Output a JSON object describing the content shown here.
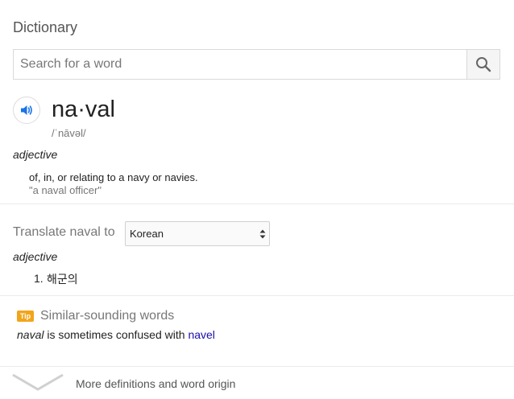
{
  "header": {
    "title": "Dictionary"
  },
  "search": {
    "placeholder": "Search for a word",
    "value": "",
    "icon": "search-icon"
  },
  "entry": {
    "headword": "na·val",
    "pronunciation": "/ˈnāvəl/",
    "audio_icon": "speaker-icon",
    "part_of_speech": "adjective",
    "definition": "of, in, or relating to a navy or navies.",
    "example": "\"a naval officer\""
  },
  "translate": {
    "label": "Translate naval to",
    "selected_language": "Korean",
    "part_of_speech": "adjective",
    "results": [
      {
        "number": "1.",
        "text": "해군의"
      }
    ]
  },
  "tip": {
    "badge": "Tip",
    "title": "Similar-sounding words",
    "word": "naval",
    "middle": " is sometimes confused with ",
    "link": "navel"
  },
  "footer": {
    "more_label": "More definitions and word origin",
    "icon": "chevron-down-icon"
  },
  "colors": {
    "accent": "#1a73e8",
    "tip_badge": "#f2a51a",
    "link": "#1a0dab"
  }
}
